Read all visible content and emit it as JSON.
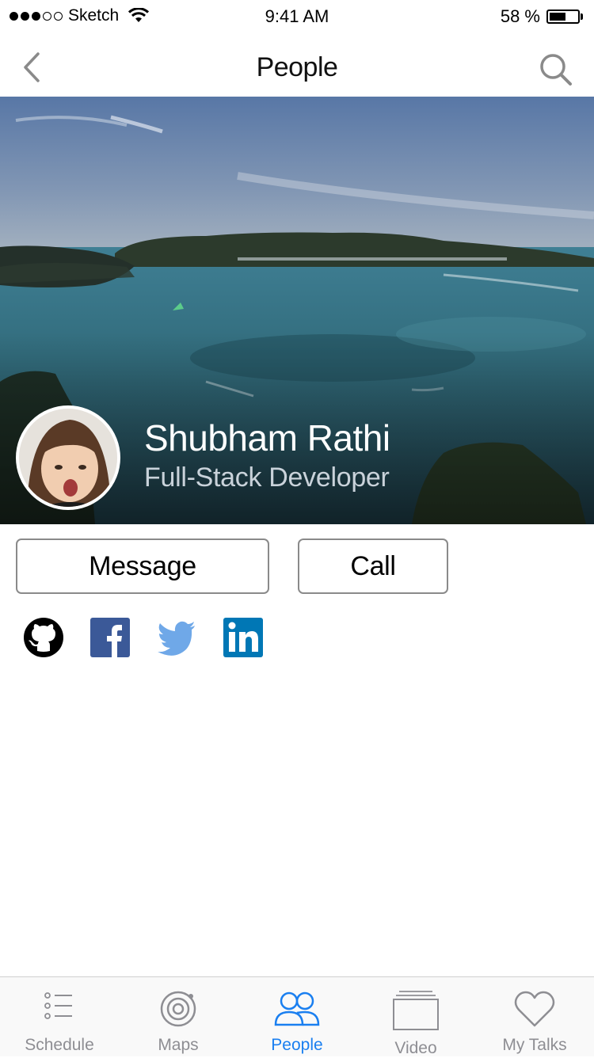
{
  "status_bar": {
    "carrier": "Sketch",
    "time": "9:41 AM",
    "battery_percent": "58 %",
    "battery_level": 0.58
  },
  "nav": {
    "title": "People",
    "back_icon": "chevron-left-icon",
    "search_icon": "search-icon"
  },
  "profile": {
    "name": "Shubham Rathi",
    "role": "Full-Stack Developer"
  },
  "actions": {
    "message_label": "Message",
    "call_label": "Call"
  },
  "social": [
    {
      "name": "github-icon",
      "color": "#000000"
    },
    {
      "name": "facebook-icon",
      "color": "#3b5998"
    },
    {
      "name": "twitter-icon",
      "color": "#6fa8e8"
    },
    {
      "name": "linkedin-icon",
      "color": "#0077b5"
    }
  ],
  "tabs": [
    {
      "label": "Schedule",
      "icon": "list-icon",
      "active": false
    },
    {
      "label": "Maps",
      "icon": "target-icon",
      "active": false
    },
    {
      "label": "People",
      "icon": "people-icon",
      "active": true
    },
    {
      "label": "Video",
      "icon": "video-stack-icon",
      "active": false
    },
    {
      "label": "My Talks",
      "icon": "heart-icon",
      "active": false
    }
  ],
  "colors": {
    "accent": "#1a7ff0",
    "tab_inactive": "#8e8e93",
    "button_border": "#8a8a8a"
  }
}
